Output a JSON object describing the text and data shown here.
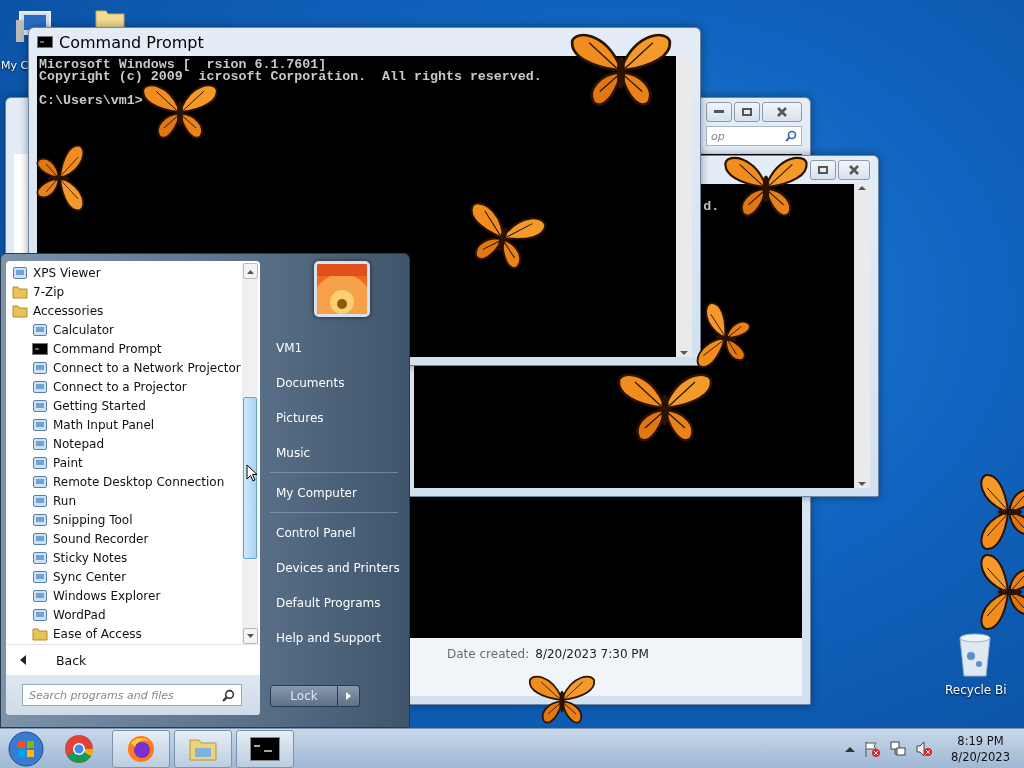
{
  "desktop": {
    "top_icon_label": "My C",
    "recycle_bin_label": "Recycle Bi"
  },
  "explorer_window": {
    "search_placeholder": "op",
    "details": [
      {
        "label": "Date created:",
        "value": "8/20/2023 7:30 PM"
      }
    ]
  },
  "second_console": {
    "lines": [
      "d."
    ]
  },
  "command_prompt": {
    "title": "Command Prompt",
    "lines": [
      [
        "Microsoft Windows [",
        "rsion 6.1.7601]"
      ],
      [
        "Copyright (c) 2009",
        "icrosoft Corporation.  All rights reserved."
      ]
    ],
    "prompt": "C:\\Users\\vm1>"
  },
  "start_menu": {
    "programs": [
      {
        "label": "XPS Viewer",
        "kind": "app"
      },
      {
        "label": "7-Zip",
        "kind": "folder"
      },
      {
        "label": "Accessories",
        "kind": "folder",
        "children": [
          {
            "label": "Calculator",
            "kind": "app"
          },
          {
            "label": "Command Prompt",
            "kind": "console"
          },
          {
            "label": "Connect to a Network Projector",
            "kind": "app"
          },
          {
            "label": "Connect to a Projector",
            "kind": "app"
          },
          {
            "label": "Getting Started",
            "kind": "app"
          },
          {
            "label": "Math Input Panel",
            "kind": "app"
          },
          {
            "label": "Notepad",
            "kind": "app"
          },
          {
            "label": "Paint",
            "kind": "app"
          },
          {
            "label": "Remote Desktop Connection",
            "kind": "app"
          },
          {
            "label": "Run",
            "kind": "app"
          },
          {
            "label": "Snipping Tool",
            "kind": "app"
          },
          {
            "label": "Sound Recorder",
            "kind": "app"
          },
          {
            "label": "Sticky Notes",
            "kind": "app"
          },
          {
            "label": "Sync Center",
            "kind": "app"
          },
          {
            "label": "Windows Explorer",
            "kind": "app"
          },
          {
            "label": "WordPad",
            "kind": "app"
          },
          {
            "label": "Ease of Access",
            "kind": "folder"
          }
        ]
      }
    ],
    "back": "Back",
    "search_placeholder": "Search programs and files",
    "places": [
      [
        "VM1",
        "Documents",
        "Pictures",
        "Music"
      ],
      [
        "My Computer"
      ],
      [
        "Control Panel",
        "Devices and Printers",
        "Default Programs",
        "Help and Support"
      ]
    ],
    "lock_button": "Lock"
  },
  "taskbar": {
    "apps": [
      {
        "kind": "chrome",
        "running": false
      },
      {
        "kind": "firefox",
        "running": true
      },
      {
        "kind": "explorer",
        "running": true
      },
      {
        "kind": "console",
        "running": true
      }
    ],
    "clock": {
      "time": "8:19 PM",
      "date": "8/20/2023"
    }
  }
}
